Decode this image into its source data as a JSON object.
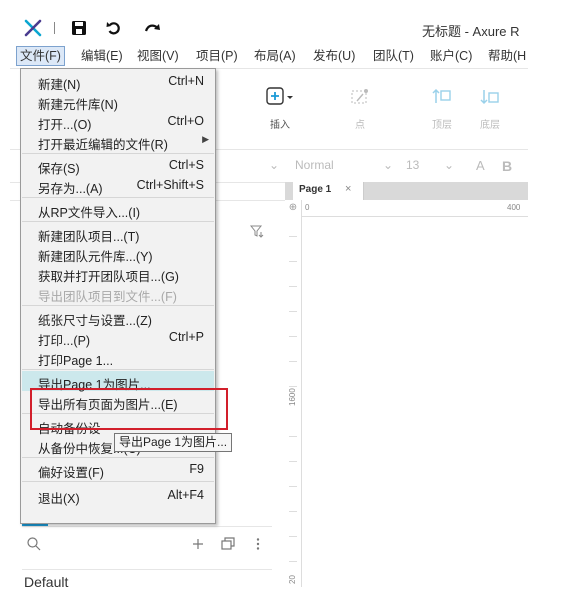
{
  "window": {
    "title": "无标题 - Axure R"
  },
  "menubar": {
    "items": [
      {
        "label": "文件(F)"
      },
      {
        "label": "编辑(E)"
      },
      {
        "label": "视图(V)"
      },
      {
        "label": "项目(P)"
      },
      {
        "label": "布局(A)"
      },
      {
        "label": "发布(U)"
      },
      {
        "label": "团队(T)"
      },
      {
        "label": "账户(C)"
      },
      {
        "label": "帮助(H"
      }
    ]
  },
  "toolbar": {
    "insert_label": "插入",
    "point_label": "点",
    "top_layer_label": "顶层",
    "bottom_layer_label": "底层"
  },
  "formatbar": {
    "style_value": "Normal",
    "size_value": "13",
    "font_a": "A",
    "bold": "B"
  },
  "canvas": {
    "tab_label": "Page 1",
    "tab_close": "×",
    "ruler_origin_symbol": "⊕",
    "ruler_ticks": {
      "h0": "0",
      "h400": "400",
      "v1600": "1600",
      "v_partial": "20"
    }
  },
  "left_panel": {
    "partial_tab_label": "3ls",
    "default_label": "Default"
  },
  "file_menu": {
    "items": [
      {
        "label": "新建(N)",
        "shortcut": "Ctrl+N"
      },
      {
        "label": "新建元件库(N)",
        "shortcut": ""
      },
      {
        "label": "打开...(O)",
        "shortcut": "Ctrl+O"
      },
      {
        "label": "打开最近编辑的文件(R)",
        "shortcut": ""
      },
      {
        "label": "保存(S)",
        "shortcut": "Ctrl+S"
      },
      {
        "label": "另存为...(A)",
        "shortcut": "Ctrl+Shift+S"
      },
      {
        "label": "从RP文件导入...(I)",
        "shortcut": ""
      },
      {
        "label": "新建团队项目...(T)",
        "shortcut": ""
      },
      {
        "label": "新建团队元件库...(Y)",
        "shortcut": ""
      },
      {
        "label": "获取并打开团队项目...(G)",
        "shortcut": ""
      },
      {
        "label": "导出团队项目到文件...(F)",
        "shortcut": ""
      },
      {
        "label": "纸张尺寸与设置...(Z)",
        "shortcut": ""
      },
      {
        "label": "打印...(P)",
        "shortcut": "Ctrl+P"
      },
      {
        "label": "打印Page 1...",
        "shortcut": ""
      },
      {
        "label": "导出Page 1为图片...",
        "shortcut": ""
      },
      {
        "label": "导出所有页面为图片...(E)",
        "shortcut": ""
      },
      {
        "label": "自动备份设",
        "shortcut": ""
      },
      {
        "label": "从备份中恢复...(C)",
        "shortcut": ""
      },
      {
        "label": "偏好设置(F)",
        "shortcut": "F9"
      },
      {
        "label": "退出(X)",
        "shortcut": "Alt+F4"
      }
    ],
    "submenu_arrow": "▶"
  },
  "tooltip": {
    "text": "导出Page 1为图片..."
  },
  "colors": {
    "accent": "#1b9ad6",
    "highlight_box": "#d21f2b",
    "hover": "#cce8ec"
  }
}
